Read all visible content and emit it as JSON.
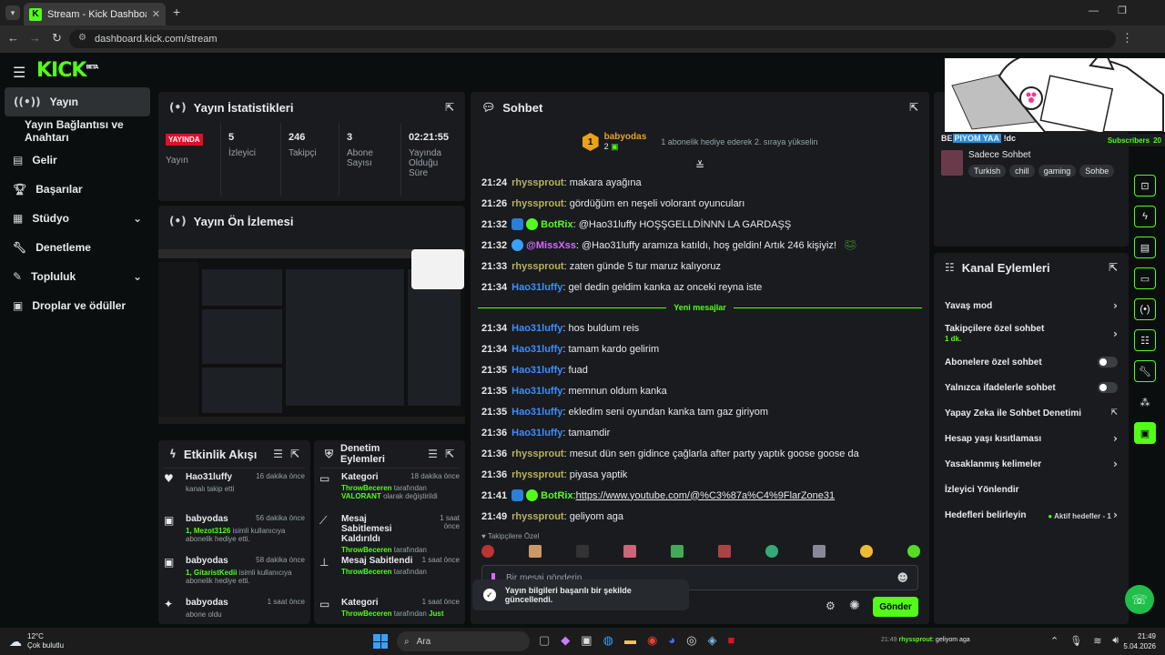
{
  "browser": {
    "tab_title": "Stream - Kick Dashboard",
    "url": "dashboard.kick.com/stream"
  },
  "kick": {
    "logo": "KICK",
    "logo_sup": "BETA"
  },
  "sidebar": {
    "items": [
      {
        "label": "Yayın",
        "icon": "broadcast-icon"
      },
      {
        "label": "Yayın Bağlantısı ve Anahtarı",
        "icon": ""
      },
      {
        "label": "Gelir",
        "icon": "revenue-icon"
      },
      {
        "label": "Başarılar",
        "icon": "trophy-icon"
      },
      {
        "label": "Stüdyo",
        "icon": "studio-icon"
      },
      {
        "label": "Denetleme",
        "icon": "wrench-icon"
      },
      {
        "label": "Topluluk",
        "icon": "community-icon"
      },
      {
        "label": "Droplar ve ödüller",
        "icon": "gift-icon"
      }
    ]
  },
  "stats": {
    "title": "Yayın İstatistikleri",
    "live_badge": "YAYINDA",
    "live_label": "Yayın",
    "cells": [
      {
        "value": "5",
        "label": "İzleyici"
      },
      {
        "value": "246",
        "label": "Takipçi"
      },
      {
        "value": "3",
        "label": "Abone Sayısı"
      },
      {
        "value": "02:21:55",
        "label": "Yayında Olduğu Süre"
      }
    ]
  },
  "preview": {
    "title": "Yayın Ön İzlemesi"
  },
  "feed": {
    "title": "Etkinlik Akışı",
    "items": [
      {
        "user": "Hao31luffy",
        "time": "16 dakika önce",
        "text": "kanalı takip etti",
        "highlight": ""
      },
      {
        "user": "babyodas",
        "time": "56 dakika önce",
        "highlight": "1, Mezot3126",
        "text": " isimli kullanıcıya abonelik hediye etti."
      },
      {
        "user": "babyodas",
        "time": "58 dakika önce",
        "highlight": "1, GitaristKedii",
        "text": " isimli kullanıcıya abonelik hediye etti."
      },
      {
        "user": "babyodas",
        "time": "1 saat önce",
        "text": "abone oldu",
        "highlight": ""
      }
    ]
  },
  "moderation": {
    "title": "Denetim Eylemleri",
    "items": [
      {
        "action": "Kategori",
        "time": "18 dakika önce",
        "by": "ThrowBeceren",
        "text": " tarafından",
        "extra": "VALORANT",
        "extra_text": " olarak değiştirildi"
      },
      {
        "action": "Mesaj Sabitlemesi Kaldırıldı",
        "time": "1 saat önce",
        "by": "ThrowBeceren",
        "text": " tarafından",
        "extra": "",
        "extra_text": ""
      },
      {
        "action": "Mesaj Sabitlendi",
        "time": "1 saat önce",
        "by": "ThrowBeceren",
        "text": " tarafından",
        "extra": "",
        "extra_text": ""
      },
      {
        "action": "Kategori",
        "time": "1 saat önce",
        "by": "ThrowBeceren",
        "text": " tarafından ",
        "extra": "Just",
        "extra_text": ""
      }
    ]
  },
  "chat": {
    "title": "Sohbet",
    "gift_user": "babyodas",
    "gift_count": "2",
    "gift_text": "1 abonelik hediye ederek 2. sıraya yükselin",
    "new_messages": "Yeni mesajlar",
    "messages": [
      {
        "time": "21:24",
        "user": "rhyssprout",
        "cls": "u-rhys",
        "badges": "",
        "text": ": makara ayağına"
      },
      {
        "time": "21:26",
        "user": "rhyssprout",
        "cls": "u-rhys",
        "badges": "",
        "text": ": gördüğüm en neşeli volorant oyuncuları"
      },
      {
        "time": "21:32",
        "user": "BotRix",
        "cls": "u-botrix",
        "badges": "bot",
        "text": ": @Hao31luffy HOŞŞGELLDİNNN LA GARDAŞŞ"
      },
      {
        "time": "21:32",
        "user": "@MissXss",
        "cls": "u-missxss",
        "badges": "robot",
        "text": ": @Hao31luffy aramıza katıldı, hoş geldin! Artık 246 kişiyiz!"
      },
      {
        "time": "21:33",
        "user": "rhyssprout",
        "cls": "u-rhys",
        "badges": "",
        "text": ": zaten günde 5 tur maruz kalıyoruz"
      },
      {
        "time": "21:34",
        "user": "Hao31luffy",
        "cls": "u-hao",
        "badges": "",
        "text": ": gel dedin geldim kanka az onceki reyna iste"
      },
      {
        "time": "21:34",
        "user": "Hao31luffy",
        "cls": "u-hao",
        "badges": "",
        "text": ": hos buldum reis"
      },
      {
        "time": "21:34",
        "user": "Hao31luffy",
        "cls": "u-hao",
        "badges": "",
        "text": ": tamam kardo gelirim"
      },
      {
        "time": "21:35",
        "user": "Hao31luffy",
        "cls": "u-hao",
        "badges": "",
        "text": ": fuad"
      },
      {
        "time": "21:35",
        "user": "Hao31luffy",
        "cls": "u-hao",
        "badges": "",
        "text": ": memnun oldum kanka"
      },
      {
        "time": "21:35",
        "user": "Hao31luffy",
        "cls": "u-hao",
        "badges": "",
        "text": ": ekledim seni oyundan kanka tam gaz giriyom"
      },
      {
        "time": "21:36",
        "user": "Hao31luffy",
        "cls": "u-hao",
        "badges": "",
        "text": ": tamamdir"
      },
      {
        "time": "21:36",
        "user": "rhyssprout",
        "cls": "u-rhys",
        "badges": "",
        "text": ": mesut dün sen gidince çağlarla after party yaptık goose goose da"
      },
      {
        "time": "21:36",
        "user": "rhyssprout",
        "cls": "u-rhys",
        "badges": "",
        "text": ": piyasa yaptik"
      },
      {
        "time": "21:41",
        "user": "BotRix",
        "cls": "u-botrix",
        "badges": "bot",
        "text": ": ",
        "link": "https://www.youtube.com/@%C3%87a%C4%9FlarZone31"
      },
      {
        "time": "21:49",
        "user": "rhyssprout",
        "cls": "u-rhys",
        "badges": "",
        "text": ": geliyom aga"
      }
    ],
    "followers_only": "Takipçilere Özel",
    "input_placeholder": "Bir mesaj gönderin",
    "toast": "Yayın bilgileri başarılı bir şekilde güncellendi.",
    "send": "Gönder"
  },
  "info_panel": {
    "title_prefix": "BE",
    "title_mid": "PIYOM YAA",
    "title_tail": "!dc",
    "overlay_subs": "Subscribers",
    "overlay_count": "20",
    "category": "Sadece Sohbet",
    "tags": [
      "Turkish",
      "chill",
      "gaming",
      "Sohbe"
    ]
  },
  "channel_actions": {
    "title": "Kanal Eylemleri",
    "items": [
      {
        "label": "Yavaş mod",
        "control": "chevron"
      },
      {
        "label": "Takipçilere özel sohbet",
        "sub": "1 dk.",
        "control": "chevron"
      },
      {
        "label": "Abonelere özel sohbet",
        "control": "toggle"
      },
      {
        "label": "Yalnızca ifadelerle sohbet",
        "control": "toggle"
      },
      {
        "label": "Yapay Zeka ile Sohbet Denetimi",
        "control": "external"
      },
      {
        "label": "Hesap yaşı kısıtlaması",
        "control": "chevron"
      },
      {
        "label": "Yasaklanmış kelimeler",
        "control": "chevron"
      },
      {
        "label": "İzleyici Yönlendir",
        "control": ""
      },
      {
        "label": "Hedefleri belirleyin",
        "sub_right": "Aktif hedefler - 1",
        "control": "chevron"
      }
    ]
  },
  "taskbar": {
    "weather_temp": "12°C",
    "weather_text": "Çok bulutlu",
    "search": "Ara",
    "ticker_time": "21:49",
    "ticker_user": "rhyssprout",
    "ticker_text": ": geliyom aga",
    "clock_time": "21:49",
    "clock_date": "5.04.2026"
  },
  "colors": {
    "accent": "#53fc18",
    "panel": "#191b1f",
    "bg": "#0b0e0f"
  }
}
